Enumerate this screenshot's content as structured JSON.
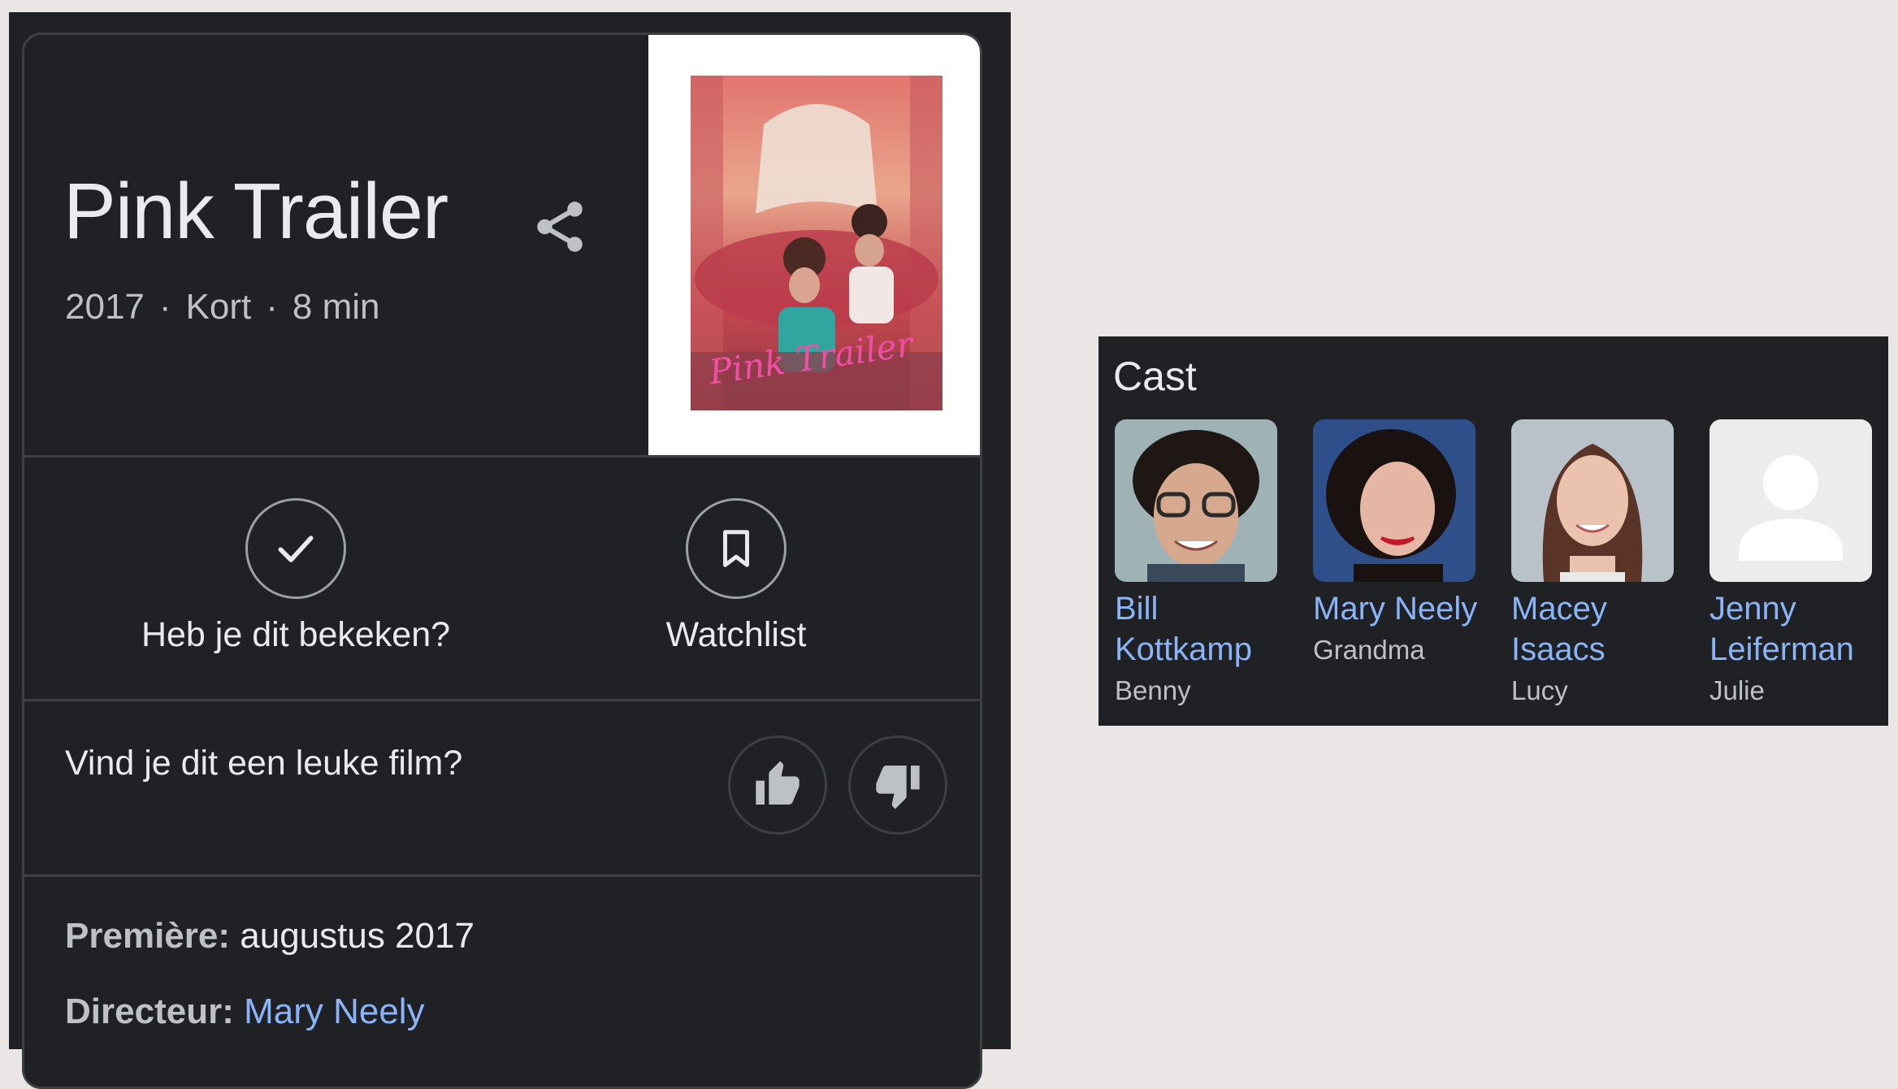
{
  "movie": {
    "title": "Pink Trailer",
    "year": "2017",
    "genre": "Kort",
    "duration": "8 min",
    "separator": "·",
    "poster_script_text": "Pink Trailer"
  },
  "actions": {
    "seen_label": "Heb je dit bekeken?",
    "watchlist_label": "Watchlist"
  },
  "rating": {
    "question": "Vind je dit een leuke film?"
  },
  "details": {
    "premiere_label": "Première:",
    "premiere_value": "augustus 2017",
    "director_label": "Directeur:",
    "director_value": "Mary Neely"
  },
  "cast": {
    "title": "Cast",
    "members": [
      {
        "first": "Bill",
        "last": "Kottkamp",
        "role": "Benny"
      },
      {
        "name": "Mary Neely",
        "role": "Grandma"
      },
      {
        "first": "Macey",
        "last": "Isaacs",
        "role": "Lucy"
      },
      {
        "first": "Jenny",
        "last": "Leiferman",
        "role": "Julie"
      }
    ]
  },
  "colors": {
    "background": "#202124",
    "text": "#e8eaed",
    "secondary_text": "#bdc1c6",
    "link": "#8ab4f8",
    "divider": "#3c4043",
    "poster_pink": "#e07a86"
  },
  "icons": [
    "share-icon",
    "check-icon",
    "bookmark-icon",
    "thumbs-up-icon",
    "thumbs-down-icon",
    "person-placeholder-icon"
  ]
}
